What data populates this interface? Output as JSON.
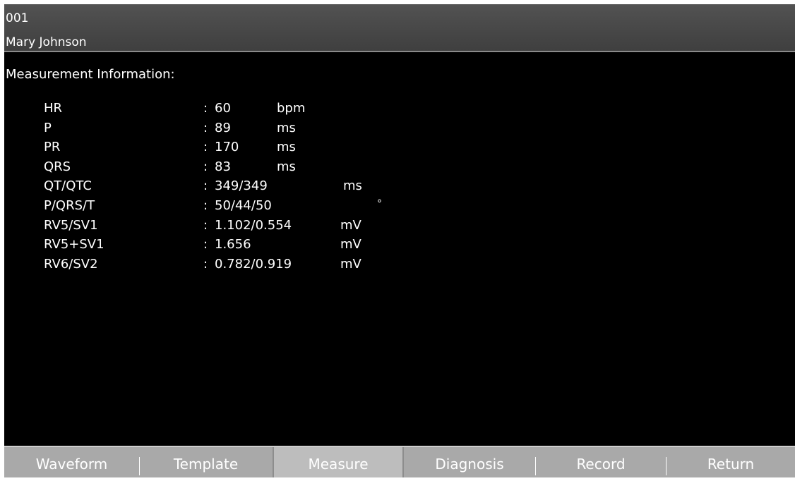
{
  "header": {
    "id": "001",
    "patient_name": "Mary Johnson"
  },
  "section_title": "Measurement Information:",
  "measurements": [
    {
      "label": "HR",
      "colon": ":",
      "value": "60",
      "unit": "bpm"
    },
    {
      "label": "P",
      "colon": ":",
      "value": "89",
      "unit": "ms"
    },
    {
      "label": "PR",
      "colon": ":",
      "value": "170",
      "unit": "ms"
    },
    {
      "label": "QRS",
      "colon": ":",
      "value": "83",
      "unit": "ms"
    },
    {
      "label": "QT/QTC",
      "colon": ":",
      "value": "349/349",
      "unit": "ms"
    },
    {
      "label": "P/QRS/T",
      "colon": ":",
      "value": "50/44/50",
      "unit": "°"
    },
    {
      "label": "RV5/SV1",
      "colon": ":",
      "value": "1.102/0.554",
      "unit": "mV"
    },
    {
      "label": "RV5+SV1",
      "colon": ":",
      "value": "1.656",
      "unit": "mV"
    },
    {
      "label": "RV6/SV2",
      "colon": ":",
      "value": "0.782/0.919",
      "unit": "mV"
    }
  ],
  "toolbar": {
    "tabs": [
      {
        "label": "Waveform"
      },
      {
        "label": "Template"
      },
      {
        "label": "Measure"
      },
      {
        "label": "Diagnosis"
      },
      {
        "label": "Record"
      },
      {
        "label": "Return"
      }
    ],
    "active": "Measure"
  }
}
